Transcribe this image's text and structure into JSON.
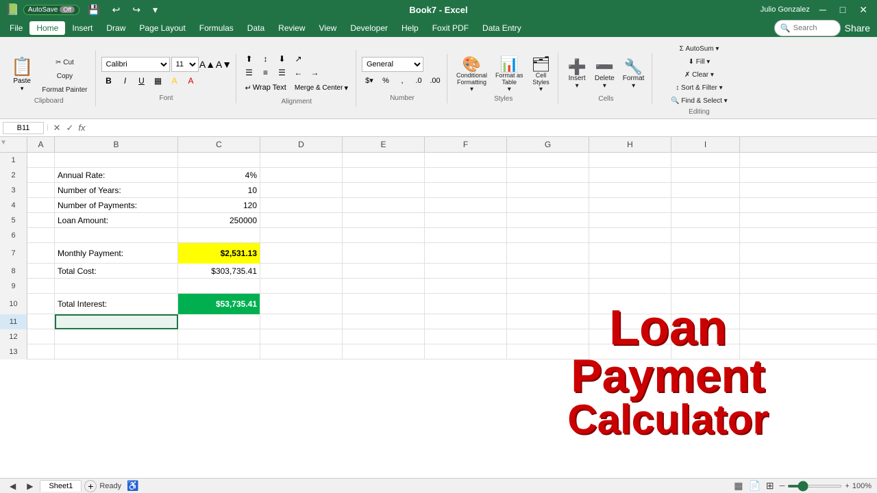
{
  "titlebar": {
    "autosave_label": "AutoSave",
    "autosave_state": "Off",
    "file_title": "Book7 - Excel",
    "user": "Julio Gonzalez"
  },
  "menu": {
    "items": [
      "File",
      "Home",
      "Insert",
      "Draw",
      "Page Layout",
      "Formulas",
      "Data",
      "Review",
      "View",
      "Developer",
      "Help",
      "Foxit PDF",
      "Data Entry",
      "Search"
    ]
  },
  "ribbon": {
    "clipboard": {
      "paste_label": "Paste",
      "cut_label": "✂ Cut",
      "copy_label": "Copy",
      "format_painter_label": "Format Painter",
      "group_label": "Clipboard"
    },
    "font": {
      "font_name": "Calibri",
      "font_size": "11",
      "bold": "B",
      "italic": "I",
      "underline": "U",
      "group_label": "Font"
    },
    "alignment": {
      "wrap_text": "Wrap Text",
      "merge_center": "Merge & Center",
      "group_label": "Alignment"
    },
    "number": {
      "format": "General",
      "currency": "$",
      "percent": "%",
      "comma": ",",
      "group_label": "Number"
    },
    "styles": {
      "conditional": "Conditional Formatting",
      "format_as_table": "Format as Table",
      "cell_styles": "Cell Styles",
      "group_label": "Styles"
    },
    "cells": {
      "insert": "Insert",
      "delete": "Delete",
      "format": "Format",
      "group_label": "Cells"
    },
    "editing": {
      "autosum": "AutoSum",
      "fill": "Fill",
      "clear": "Clear",
      "sort_filter": "Sort & Filter",
      "find_select": "Find & Select",
      "group_label": "Editing"
    }
  },
  "formula_bar": {
    "cell_ref": "B11",
    "formula": ""
  },
  "columns": [
    "A",
    "B",
    "C",
    "D",
    "E",
    "F",
    "G",
    "H",
    "I"
  ],
  "rows": [
    {
      "num": 1,
      "cells": [
        "",
        "",
        "",
        "",
        "",
        "",
        "",
        "",
        ""
      ]
    },
    {
      "num": 2,
      "cells": [
        "",
        "Annual Rate:",
        "4%",
        "",
        "",
        "",
        "",
        "",
        ""
      ]
    },
    {
      "num": 3,
      "cells": [
        "",
        "Number of Years:",
        "10",
        "",
        "",
        "",
        "",
        "",
        ""
      ]
    },
    {
      "num": 4,
      "cells": [
        "",
        "Number of Payments:",
        "120",
        "",
        "",
        "",
        "",
        "",
        ""
      ]
    },
    {
      "num": 5,
      "cells": [
        "",
        "Loan Amount:",
        "250000",
        "",
        "",
        "",
        "",
        "",
        ""
      ]
    },
    {
      "num": 6,
      "cells": [
        "",
        "",
        "",
        "",
        "",
        "",
        "",
        "",
        ""
      ]
    },
    {
      "num": 7,
      "cells": [
        "",
        "Monthly Payment:",
        "$2,531.13",
        "",
        "",
        "",
        "",
        "",
        ""
      ]
    },
    {
      "num": 8,
      "cells": [
        "",
        "Total Cost:",
        "$303,735.41",
        "",
        "",
        "",
        "",
        "",
        ""
      ]
    },
    {
      "num": 9,
      "cells": [
        "",
        "",
        "",
        "",
        "",
        "",
        "",
        "",
        ""
      ]
    },
    {
      "num": 10,
      "cells": [
        "",
        "Total Interest:",
        "$53,735.41",
        "",
        "",
        "",
        "",
        "",
        ""
      ]
    },
    {
      "num": 11,
      "cells": [
        "",
        "",
        "",
        "",
        "",
        "",
        "",
        "",
        ""
      ]
    },
    {
      "num": 12,
      "cells": [
        "",
        "",
        "",
        "",
        "",
        "",
        "",
        "",
        ""
      ]
    },
    {
      "num": 13,
      "cells": [
        "",
        "",
        "",
        "",
        "",
        "",
        "",
        "",
        ""
      ]
    }
  ],
  "loan_title": {
    "line1": "Loan",
    "line2": "Payment",
    "line3": "Calculator"
  },
  "sheet_tabs": [
    "Sheet1"
  ],
  "status": {
    "ready": "Ready",
    "zoom": "100%"
  }
}
